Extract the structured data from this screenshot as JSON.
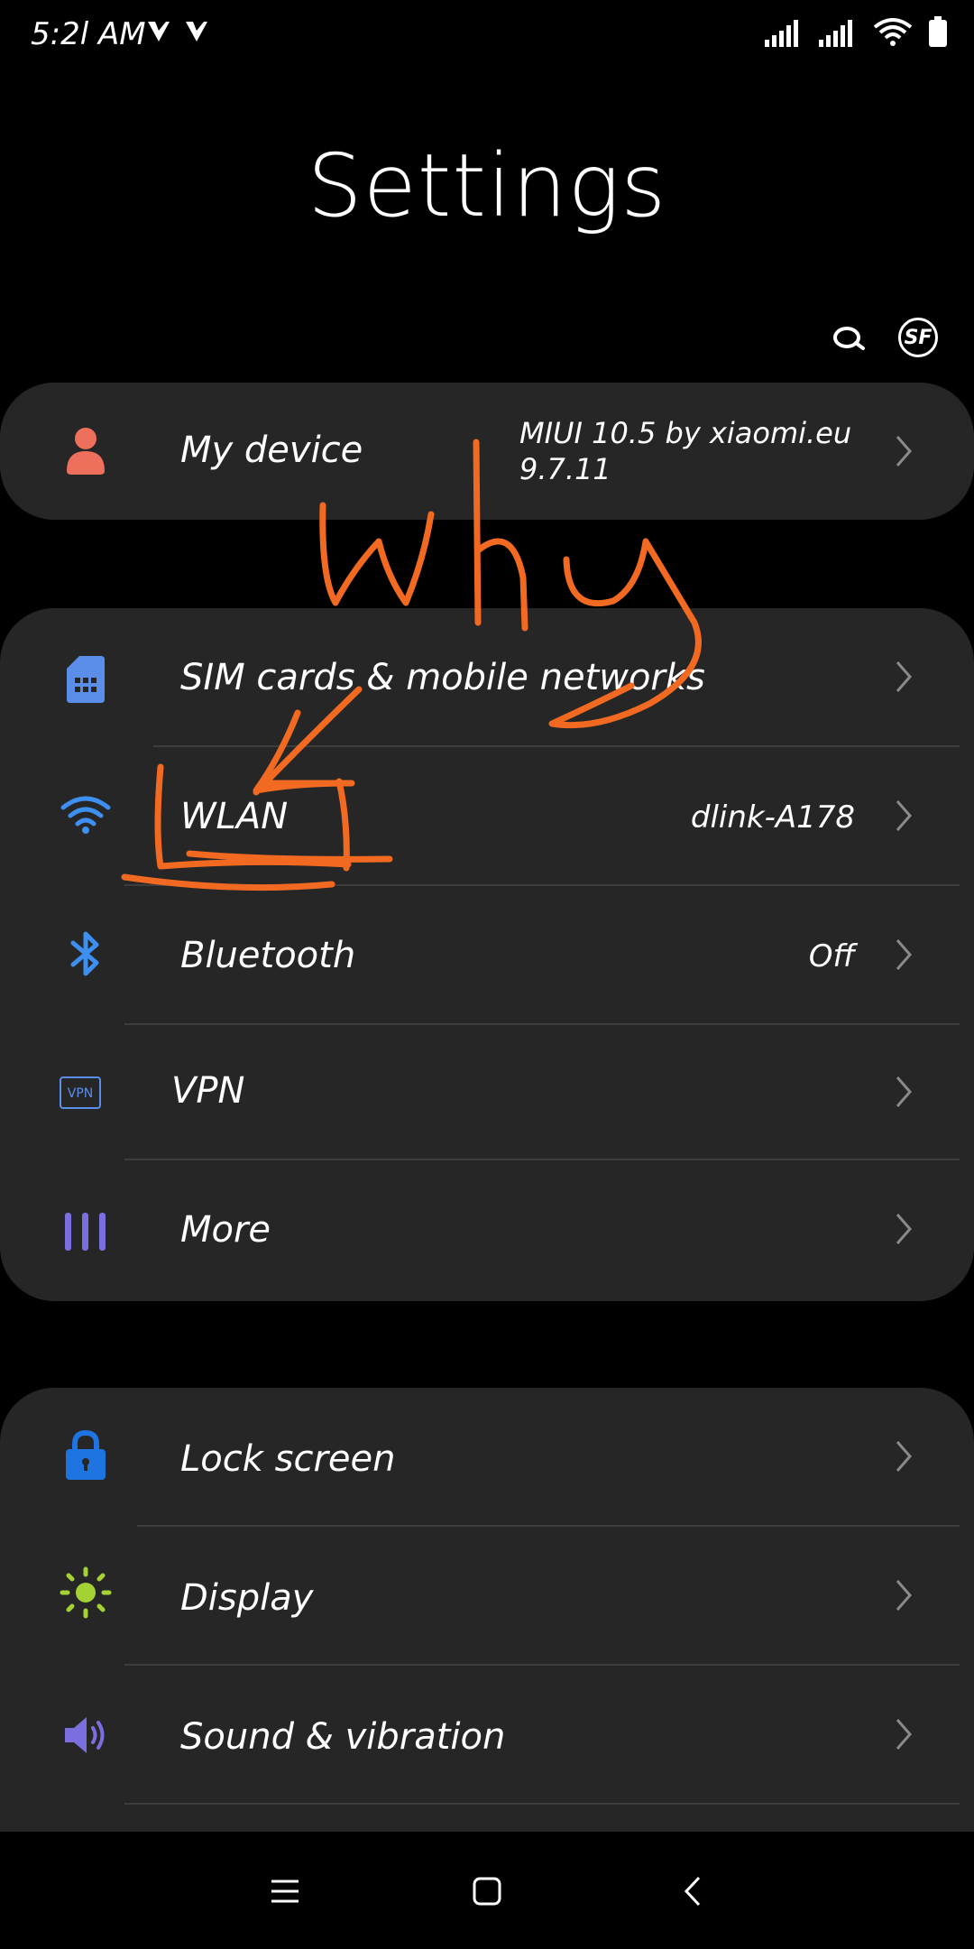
{
  "status_bar": {
    "time": "5:2l AM",
    "left_icons": [
      "notification-check-icon",
      "notification-check-icon"
    ],
    "right_icons": [
      "signal-icon",
      "signal-icon",
      "wifi-icon",
      "battery-icon"
    ]
  },
  "header": {
    "title": "Settings",
    "search_icon": "search-icon",
    "avatar_text": "SF"
  },
  "sections": [
    {
      "rows": [
        {
          "label": "My device",
          "value_line1": "MIUI 10.5 by xiaomi.eu",
          "value_line2": "9.7.11",
          "icon": "person-icon",
          "icon_color": "#ef6f5d"
        }
      ]
    },
    {
      "rows": [
        {
          "label": "SIM cards & mobile networks",
          "value": "",
          "icon": "sim-card-icon",
          "icon_color": "#5a8ee8"
        },
        {
          "label": "WLAN",
          "value": "dlink-A178",
          "icon": "wifi-icon",
          "icon_color": "#3d8ff0"
        },
        {
          "label": "Bluetooth",
          "value": "Off",
          "icon": "bluetooth-icon",
          "icon_color": "#3d8ff0"
        },
        {
          "label": "VPN",
          "value": "",
          "icon": "vpn-icon",
          "icon_color": "#5a8ee8",
          "icon_text": "VPN"
        },
        {
          "label": "More",
          "value": "",
          "icon": "more-icon",
          "icon_color": "#7b6fe0"
        }
      ]
    },
    {
      "rows": [
        {
          "label": "Lock screen",
          "value": "",
          "icon": "lock-icon",
          "icon_color": "#1e74e0"
        },
        {
          "label": "Display",
          "value": "",
          "icon": "display-sun-icon",
          "icon_color": "#a4d235"
        },
        {
          "label": "Sound & vibration",
          "value": "",
          "icon": "speaker-icon",
          "icon_color": "#7b6fe0"
        }
      ]
    }
  ],
  "annotation": {
    "text": "why",
    "color": "#f26a22"
  },
  "nav_bar": {
    "icons": [
      "menu-icon",
      "home-icon",
      "back-icon"
    ]
  }
}
